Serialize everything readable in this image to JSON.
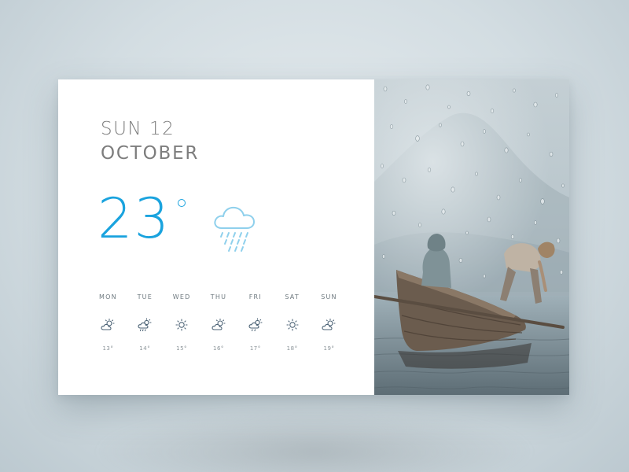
{
  "date": {
    "day": "SUN 12",
    "month": "OCTOBER"
  },
  "current": {
    "temperature": "23",
    "icon": "rain-cloud-icon"
  },
  "forecast": [
    {
      "day": "MON",
      "icon": "partly-cloudy-icon",
      "temp": "13°"
    },
    {
      "day": "TUE",
      "icon": "cloud-rain-icon",
      "temp": "14°"
    },
    {
      "day": "WED",
      "icon": "sun-icon",
      "temp": "15°"
    },
    {
      "day": "THU",
      "icon": "partly-cloudy-icon",
      "temp": "16°"
    },
    {
      "day": "FRI",
      "icon": "cloud-rain-sun-icon",
      "temp": "17°"
    },
    {
      "day": "SAT",
      "icon": "sun-icon",
      "temp": "18°"
    },
    {
      "day": "SUN",
      "icon": "partly-cloudy-icon",
      "temp": "19°"
    }
  ],
  "colors": {
    "accent": "#1aa3de",
    "icon_accent": "#8fd0ec",
    "forecast_icon": "#4b6275",
    "date_text": "#7d7d7d"
  },
  "photo": {
    "subject": "rainy-boat-photo"
  }
}
